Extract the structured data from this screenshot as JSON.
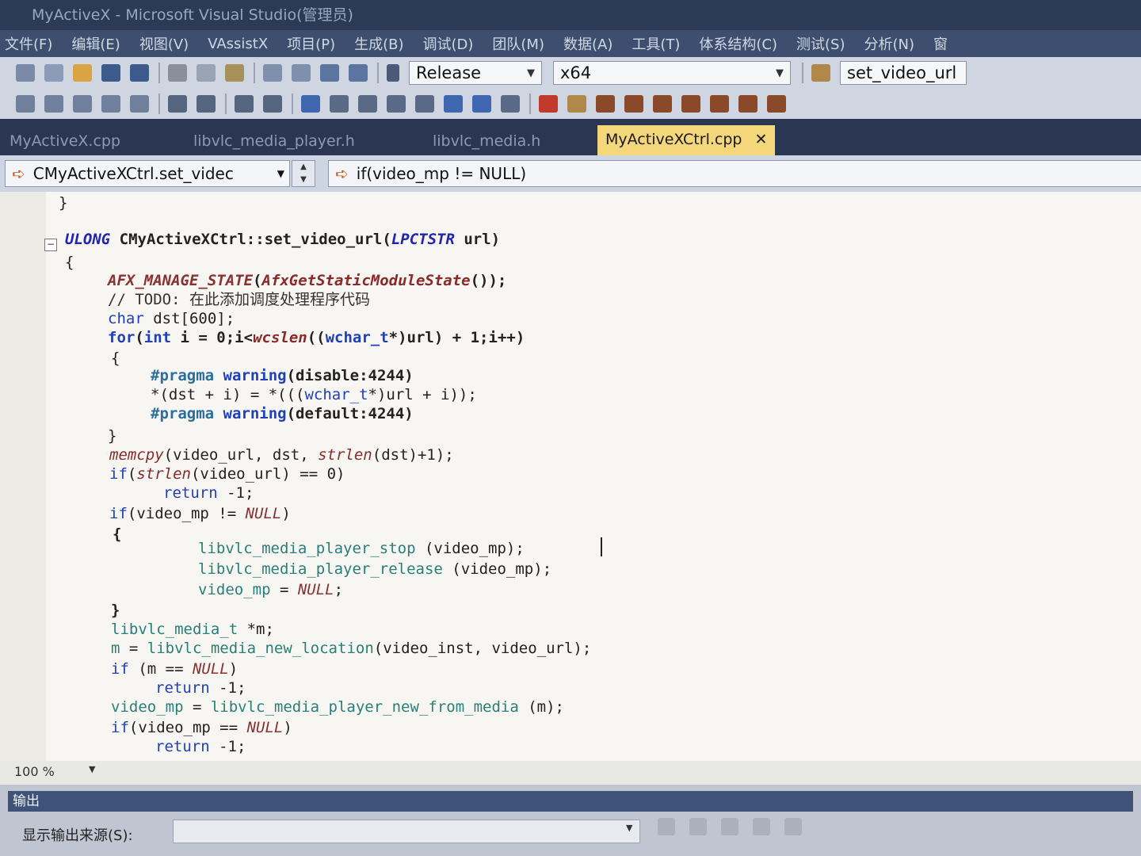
{
  "window": {
    "title": "MyActiveX - Microsoft Visual Studio(管理员)"
  },
  "menu": [
    "文件(F)",
    "编辑(E)",
    "视图(V)",
    "VAssistX",
    "项目(P)",
    "生成(B)",
    "调试(D)",
    "团队(M)",
    "数据(A)",
    "工具(T)",
    "体系结构(C)",
    "测试(S)",
    "分析(N)",
    "窗"
  ],
  "toolbar": {
    "configuration": "Release",
    "platform": "x64",
    "find_value": "set_video_url"
  },
  "tabs": [
    {
      "label": "MyActiveX.cpp",
      "active": false
    },
    {
      "label": "libvlc_media_player.h",
      "active": false
    },
    {
      "label": "libvlc_media.h",
      "active": false
    },
    {
      "label": "MyActiveXCtrl.cpp",
      "active": true
    }
  ],
  "tab_close_glyph": "✕",
  "navigation": {
    "scope": "CMyActiveXCtrl.set_videc",
    "member": "if(video_mp != NULL)"
  },
  "code": {
    "l00": "}",
    "l01_type": "ULONG",
    "l01_rest": " CMyActiveXCtrl::set_video_url(",
    "l01_ptype": "LPCTSTR",
    "l01_end": " url)",
    "l02": "{",
    "l03_mac": "AFX_MANAGE_STATE",
    "l03_p": "(",
    "l03_fn": "AfxGetStaticModuleState",
    "l03_end": "());",
    "l04": "// TODO: 在此添加调度处理程序代码",
    "l05_kw": "char",
    "l05_rest": " dst[600];",
    "l06_kw": "for",
    "l06_a": "(",
    "l06_kw2": "int",
    "l06_b": " i = 0;i<",
    "l06_fn": "wcslen",
    "l06_c": "((",
    "l06_kw3": "wchar_t",
    "l06_d": "*)url) + 1;i++)",
    "l07": "{",
    "l08_pp": "#pragma",
    "l08_kw": " warning",
    "l08_rest": "(disable:4244)",
    "l09_a": "*(dst + i) = *(((",
    "l09_kw": "wchar_t",
    "l09_b": "*)url + i));",
    "l10_pp": "#pragma",
    "l10_kw": " warning",
    "l10_rest": "(default:4244)",
    "l11": "}",
    "l12_fn": "memcpy",
    "l12_a": "(video_url, dst, ",
    "l12_fn2": "strlen",
    "l12_b": "(dst)+1);",
    "l13_kw": "if",
    "l13_a": "(",
    "l13_fn": "strlen",
    "l13_b": "(video_url) == 0)",
    "l14_kw": "return",
    "l14_rest": " -1;",
    "l15_kw": "if",
    "l15_a": "(video_mp != ",
    "l15_mac": "NULL",
    "l15_b": ")",
    "l16": "{",
    "l17_g": "libvlc_media_player_stop",
    "l17_rest": " (video_mp);",
    "l18_g": "libvlc_media_player_release",
    "l18_rest": " (video_mp);",
    "l19_g": "video_mp",
    "l19_a": " = ",
    "l19_mac": "NULL",
    "l19_b": ";",
    "l20": "}",
    "l21_g": "libvlc_media_t",
    "l21_rest": " *m;",
    "l22_g": "m",
    "l22_a": " = ",
    "l22_g2": "libvlc_media_new_location",
    "l22_b": "(video_inst, video_url);",
    "l23_kw": "if",
    "l23_a": " (m == ",
    "l23_mac": "NULL",
    "l23_b": ")",
    "l24_kw": "return",
    "l24_rest": " -1;",
    "l25_g": "video_mp",
    "l25_a": " = ",
    "l25_g2": "libvlc_media_player_new_from_media",
    "l25_b": " (m);",
    "l26_kw": "if",
    "l26_a": "(video_mp == ",
    "l26_mac": "NULL",
    "l26_b": ")",
    "l27_kw": "return",
    "l27_rest": " -1;"
  },
  "status": {
    "zoom": "100 %"
  },
  "output": {
    "title": "输出",
    "source_label": "显示输出来源(S):"
  },
  "colors": {
    "accent_tab": "#f5d77b",
    "keyword": "#1f3fbf",
    "macro": "#8a3232",
    "chrome_dark": "#2b3752"
  }
}
